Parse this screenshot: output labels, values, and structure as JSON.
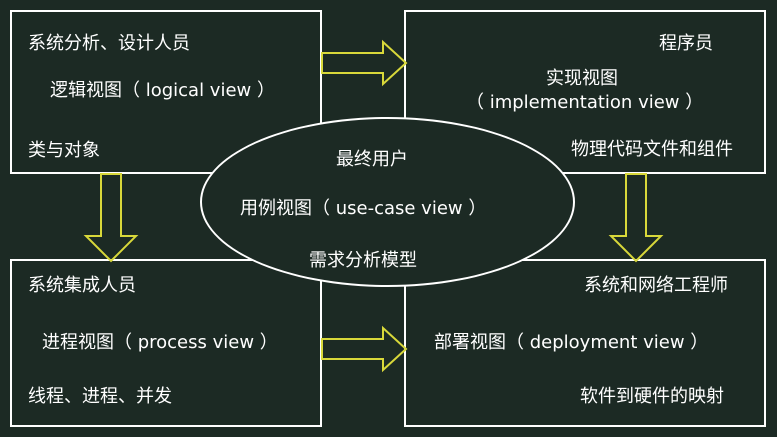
{
  "top_left": {
    "role": "系统分析、设计人员",
    "view": "逻辑视图（ logical view ）",
    "artifact": "类与对象"
  },
  "top_right": {
    "role": "程序员",
    "view_line1": "实现视图",
    "view_line2": "（ implementation view ）",
    "artifact": "物理代码文件和组件"
  },
  "bottom_left": {
    "role": "系统集成人员",
    "view": "进程视图（ process view ）",
    "artifact": "线程、进程、并发"
  },
  "bottom_right": {
    "role": "系统和网络工程师",
    "view": "部署视图（ deployment view ）",
    "artifact": "软件到硬件的映射"
  },
  "center": {
    "role": "最终用户",
    "view": "用例视图（ use-case view ）",
    "artifact": "需求分析模型"
  },
  "colors": {
    "background": "#1c2a24",
    "border": "#ffffff",
    "arrow_stroke": "#d8d83a"
  }
}
